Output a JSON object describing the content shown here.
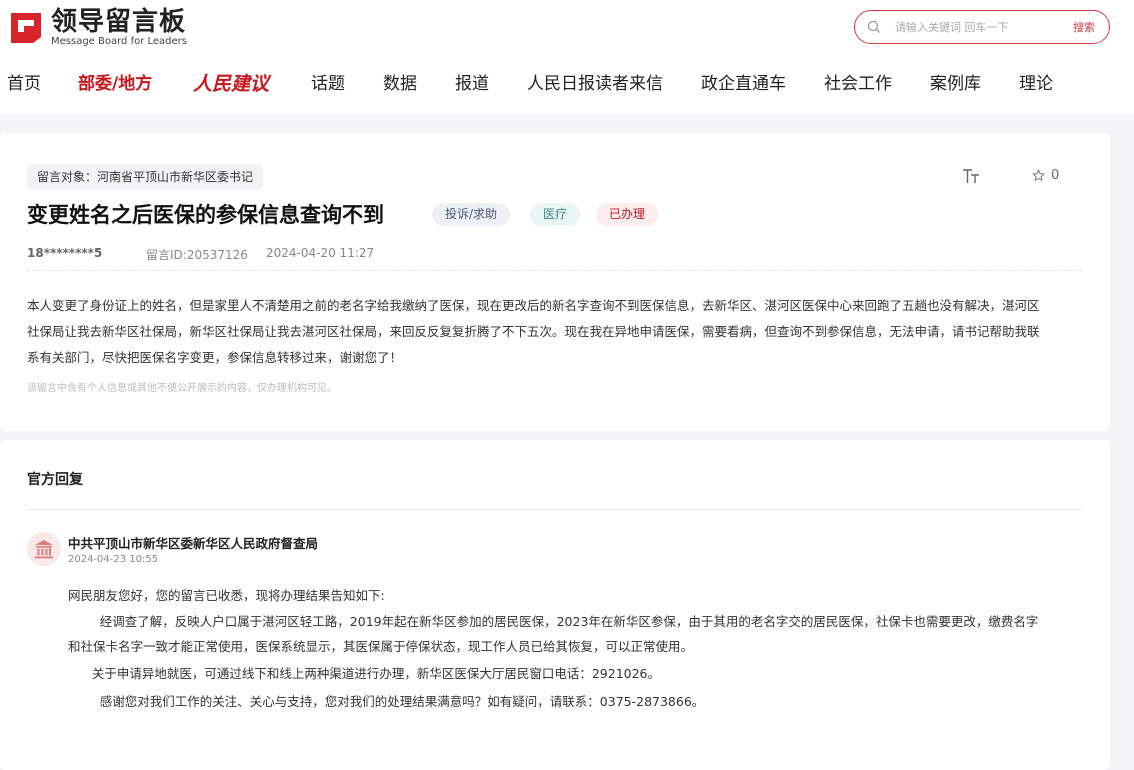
{
  "header": {
    "logo_cn": "领导留言板",
    "logo_en": "Message Board for Leaders",
    "search_placeholder": "请输入关键词 回车一下",
    "search_button": "搜索"
  },
  "nav": [
    {
      "label": "首页"
    },
    {
      "label": "部委/地方"
    },
    {
      "label": "人民建议"
    },
    {
      "label": "话题"
    },
    {
      "label": "数据"
    },
    {
      "label": "报道"
    },
    {
      "label": "人民日报读者来信"
    },
    {
      "label": "政企直通车"
    },
    {
      "label": "社会工作"
    },
    {
      "label": "案例库"
    },
    {
      "label": "理论"
    }
  ],
  "message": {
    "target": "留言对象：河南省平顶山市新华区委书记",
    "font_tool": "T T",
    "favorite_count": "0",
    "title": "变更姓名之后医保的参保信息查询不到",
    "type": "投诉/求助",
    "category": "医疗",
    "status": "已办理",
    "user": "18********5",
    "id": "留言ID:20537126",
    "time": "2024-04-20 11:27",
    "content_lines": [
      "本人变更了身份证上的姓名，但是家里人不清楚用之前的老名字给我缴纳了医保，现在更改后的新名字查询不到医保信息，去新华区、湛河区医保中心来回跑了五趟也没有解决，湛河区",
      "社保局让我去新华区社保局，新华区社保局让我去湛河区社保局，来回反反复复折腾了不下五次。现在我在异地申请医保，需要看病，但查询不到参保信息，无法申请，请书记帮助我联",
      "系有关部门，尽快把医保名字变更，参保信息转移过来，谢谢您了！"
    ],
    "privacy_note": "该留言中含有个人信息或其他不便公开展示的内容，仅办理机构可见。"
  },
  "reply": {
    "section_title": "官方回复",
    "org": "中共平顶山市新华区委新华区人民政府督查局",
    "time": "2024-04-23 10:55",
    "lines": [
      "网民朋友您好，您的留言已收悉，现将办理结果告知如下:",
      "        经调查了解，反映人户口属于湛河区轻工路，2019年起在新华区参加的居民医保，2023年在新华区参保，由于其用的老名字交的居民医保，社保卡也需要更改，缴费名字",
      "和社保卡名字一致才能正常使用，医保系统显示，其医保属于停保状态，现工作人员已给其恢复，可以正常使用。",
      "      关于申请异地就医，可通过线下和线上两种渠道进行办理，新华区医保大厅居民窗口电话：2921026。",
      "        感谢您对我们工作的关注、关心与支持，您对我们的处理结果满意吗？如有疑问，请联系：0375-2873866。"
    ]
  },
  "colors": {
    "brand_red": "#c8161d",
    "page_bg": "#f4f5f7"
  }
}
